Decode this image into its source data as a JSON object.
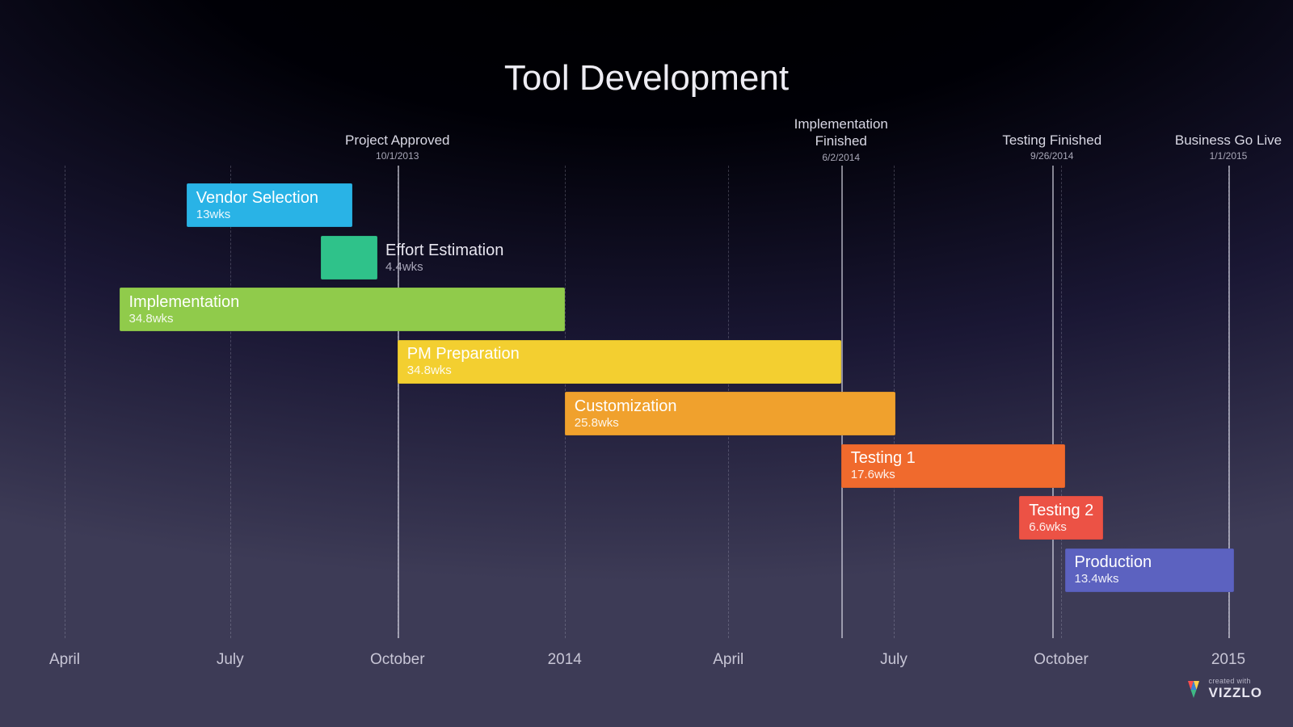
{
  "chart_data": {
    "type": "bar",
    "title": "Tool Development",
    "x_axis": {
      "start": "2013-04-01",
      "end": "2015-01-01",
      "ticks": [
        {
          "label": "April",
          "date": "2013-04-01"
        },
        {
          "label": "July",
          "date": "2013-07-01"
        },
        {
          "label": "October",
          "date": "2013-10-01"
        },
        {
          "label": "2014",
          "date": "2014-01-01"
        },
        {
          "label": "April",
          "date": "2014-04-01"
        },
        {
          "label": "July",
          "date": "2014-07-01"
        },
        {
          "label": "October",
          "date": "2014-10-01"
        },
        {
          "label": "2015",
          "date": "2015-01-01"
        }
      ]
    },
    "milestones": [
      {
        "label": "Project Approved",
        "date": "2013-10-01",
        "date_display": "10/1/2013"
      },
      {
        "label": "Implementation\nFinished",
        "date": "2014-06-02",
        "date_display": "6/2/2014"
      },
      {
        "label": "Testing Finished",
        "date": "2014-09-26",
        "date_display": "9/26/2014"
      },
      {
        "label": "Business Go Live",
        "date": "2015-01-01",
        "date_display": "1/1/2015"
      }
    ],
    "tasks": [
      {
        "name": "Vendor Selection",
        "duration": "13wks",
        "start": "2013-06-07",
        "end": "2013-09-06",
        "color": "#29b3e6",
        "label_external": false
      },
      {
        "name": "Effort Estimation",
        "duration": "4.4wks",
        "start": "2013-08-20",
        "end": "2013-09-20",
        "color": "#2fc28a",
        "label_external": true
      },
      {
        "name": "Implementation",
        "duration": "34.8wks",
        "start": "2013-05-01",
        "end": "2014-01-01",
        "color": "#90cb4b",
        "label_external": false
      },
      {
        "name": "PM Preparation",
        "duration": "34.8wks",
        "start": "2013-10-01",
        "end": "2014-06-02",
        "color": "#f3cf30",
        "label_external": false
      },
      {
        "name": "Customization",
        "duration": "25.8wks",
        "start": "2014-01-01",
        "end": "2014-07-02",
        "color": "#f0a12d",
        "label_external": false
      },
      {
        "name": "Testing 1",
        "duration": "17.6wks",
        "start": "2014-06-02",
        "end": "2014-10-03",
        "color": "#f06a2d",
        "label_external": false
      },
      {
        "name": "Testing 2",
        "duration": "6.6wks",
        "start": "2014-09-08",
        "end": "2014-10-24",
        "color": "#ec5245",
        "label_external": false
      },
      {
        "name": "Production",
        "duration": "13.4wks",
        "start": "2014-10-03",
        "end": "2015-01-04",
        "color": "#5c62c0",
        "label_external": false
      }
    ]
  },
  "branding": {
    "created_with": "created with",
    "brand": "VIZZLO"
  }
}
